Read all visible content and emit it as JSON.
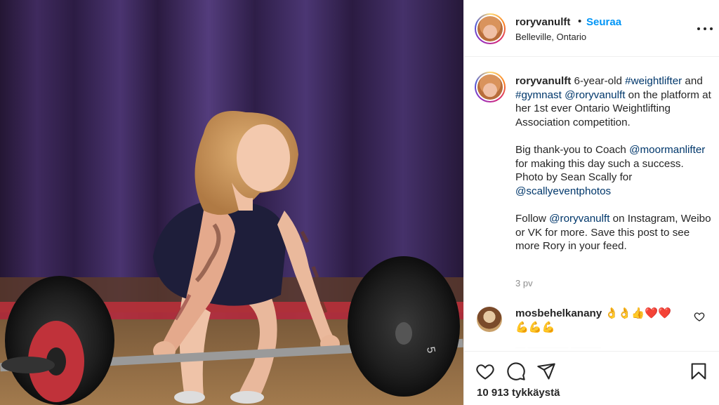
{
  "header": {
    "username": "roryvanulft",
    "separator": "•",
    "follow_label": "Seuraa",
    "location": "Belleville, Ontario"
  },
  "caption": {
    "username": "roryvanulft",
    "p1_text1": " 6-year-old ",
    "p1_tag1": "#weightlifter",
    "p1_text2": " and ",
    "p1_tag2": "#gymnast",
    "p1_text3": " ",
    "p1_mention": "@roryvanulft",
    "p1_text4": " on the platform at her 1st ever Ontario Weightlifting Association competition.",
    "p2_text1": "Big thank-you to Coach ",
    "p2_mention1": "@moormanlifter",
    "p2_text2": " for making this day such a success. Photo by Sean Scally for ",
    "p2_mention2": "@scallyeventphotos",
    "p3_text1": "Follow ",
    "p3_mention": "@roryvanulft",
    "p3_text2": " on Instagram, Weibo or VK for more. Save this post to see more Rory in your feed.",
    "age": "3 pv"
  },
  "comment": {
    "username": "mosbehelkanany",
    "text": " 👌👌👍❤️❤️💪💪💪"
  },
  "footer": {
    "likes": "10 913 tykkäystä"
  },
  "colors": {
    "link": "#00376b",
    "follow": "#0095f6",
    "heart": "#e0245e"
  },
  "icons": [
    "more-options-icon",
    "heart-icon",
    "comment-icon",
    "share-icon",
    "save-icon"
  ]
}
